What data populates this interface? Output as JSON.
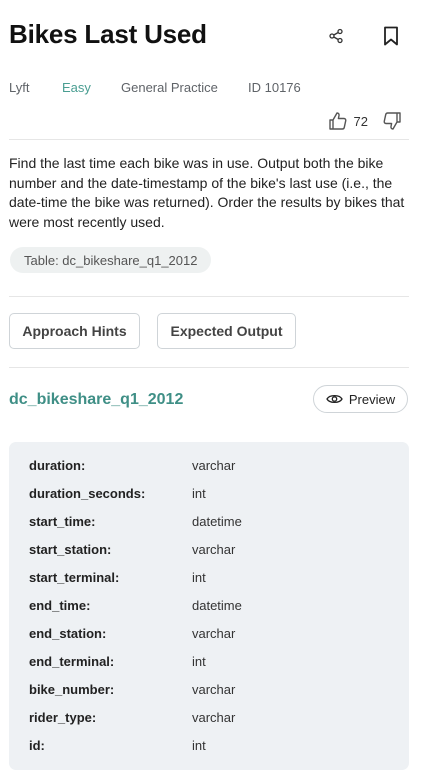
{
  "header": {
    "title": "Bikes Last Used",
    "company": "Lyft",
    "difficulty": "Easy",
    "category": "General Practice",
    "question_id": "ID 10176",
    "like_count": "72",
    "icons": {
      "share": "share-icon",
      "bookmark": "bookmark-icon",
      "like": "thumbs-up-icon",
      "dislike": "thumbs-down-icon"
    }
  },
  "question": {
    "description": "Find the last time each bike was in use. Output both the bike number and the date-timestamp of the bike's last use (i.e., the date-time the bike was returned). Order the results by bikes that were most recently used.",
    "table_chip": "Table: dc_bikeshare_q1_2012"
  },
  "tabs": {
    "approach_hints": "Approach Hints",
    "expected_output": "Expected Output"
  },
  "schema": {
    "table_name": "dc_bikeshare_q1_2012",
    "preview_label": "Preview",
    "columns": [
      {
        "name": "duration:",
        "type": "varchar"
      },
      {
        "name": "duration_seconds:",
        "type": "int"
      },
      {
        "name": "start_time:",
        "type": "datetime"
      },
      {
        "name": "start_station:",
        "type": "varchar"
      },
      {
        "name": "start_terminal:",
        "type": "int"
      },
      {
        "name": "end_time:",
        "type": "datetime"
      },
      {
        "name": "end_station:",
        "type": "varchar"
      },
      {
        "name": "end_terminal:",
        "type": "int"
      },
      {
        "name": "bike_number:",
        "type": "varchar"
      },
      {
        "name": "rider_type:",
        "type": "varchar"
      },
      {
        "name": "id:",
        "type": "int"
      }
    ]
  },
  "colors": {
    "accent": "#3f8f86",
    "difficulty_easy": "#4a9e92",
    "schema_bg": "#eef1f4"
  }
}
